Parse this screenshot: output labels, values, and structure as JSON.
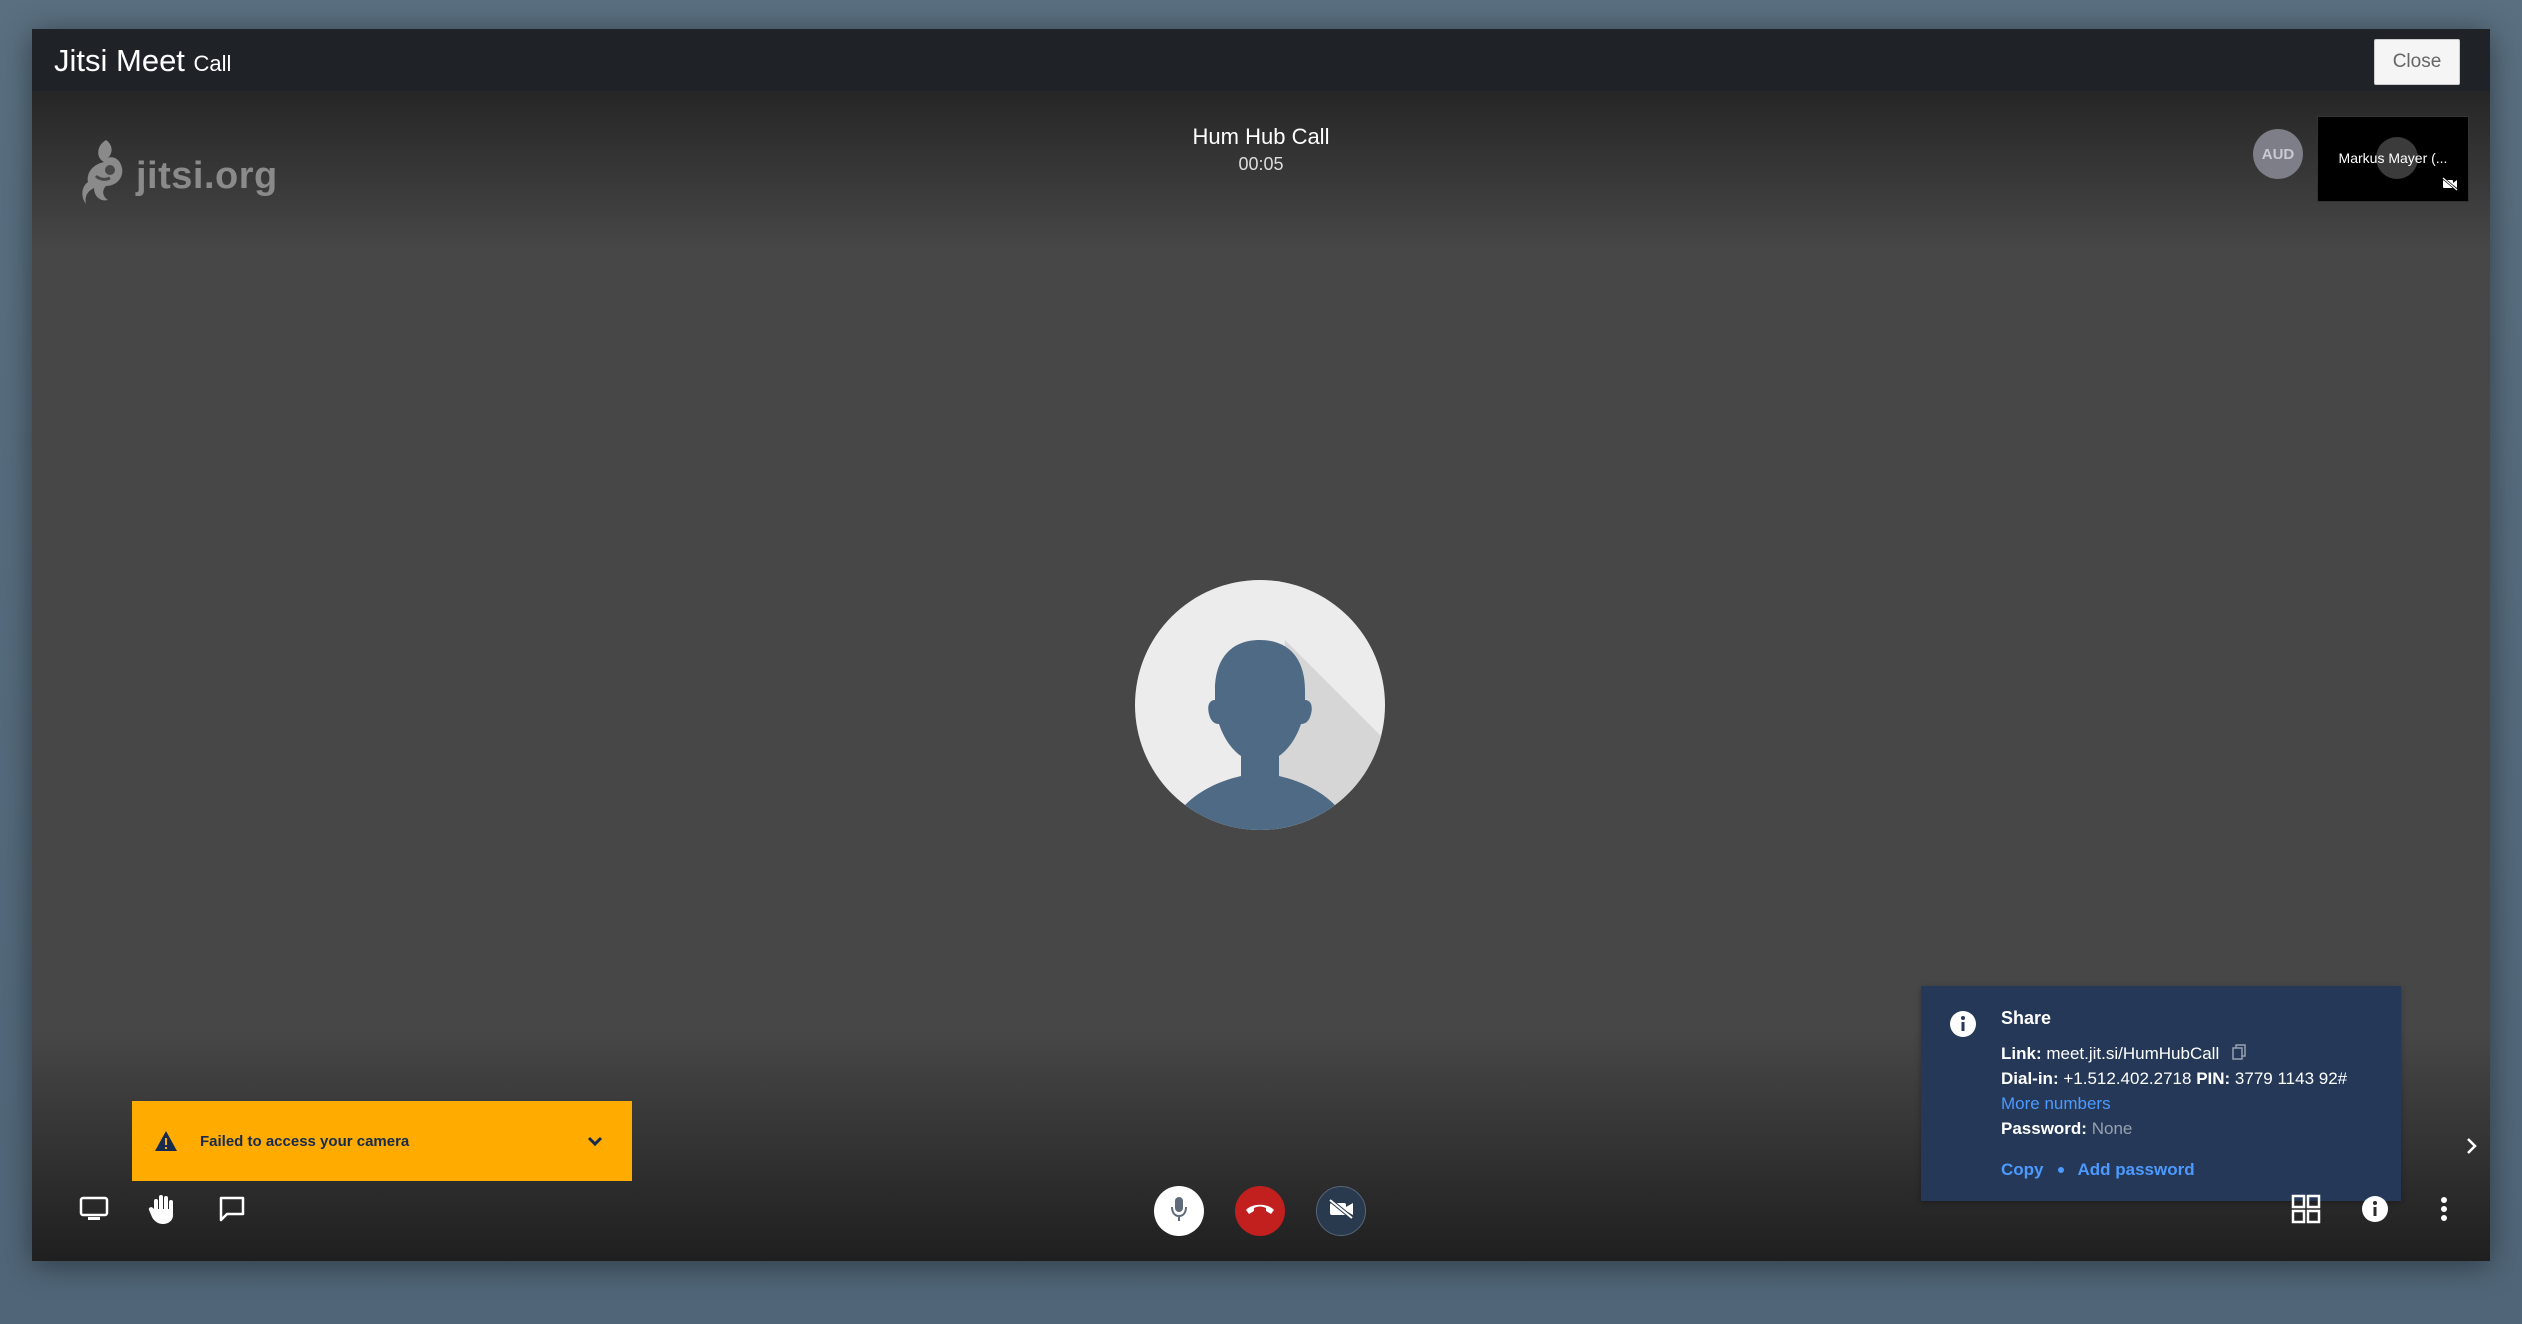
{
  "window": {
    "title": "Jitsi Meet",
    "subtitle": "Call",
    "close_label": "Close"
  },
  "logo": {
    "text": "jitsi.org",
    "icon": "jitsi-logo-icon"
  },
  "call": {
    "name": "Hum Hub Call",
    "timer": "00:05"
  },
  "filmstrip": {
    "audio_avatar_label": "AUD",
    "local_video_name": "Markus Mayer (...",
    "local_video_icon": "camera-off-icon"
  },
  "notification": {
    "message": "Failed to access your camera",
    "icon": "warning-icon",
    "expand_icon": "chevron-down-icon",
    "color": "#ffab00"
  },
  "share": {
    "title": "Share",
    "link_label": "Link:",
    "link_value": "meet.jit.si/HumHubCall",
    "dialin_label": "Dial-in:",
    "dialin_value": "+1.512.402.2718",
    "pin_label": "PIN:",
    "pin_value": "3779 1143 92#",
    "more_numbers": "More numbers",
    "password_label": "Password:",
    "password_value": "None",
    "copy_label": "Copy",
    "add_password_label": "Add password",
    "background": "#253858",
    "link_color": "#4c9aff"
  },
  "toolbar": {
    "left": [
      "screen-share-icon",
      "raise-hand-icon",
      "chat-icon"
    ],
    "center": [
      "microphone-icon",
      "hangup-icon",
      "camera-off-icon"
    ],
    "right": [
      "tile-view-icon",
      "info-icon",
      "more-options-icon"
    ],
    "hangup_color": "#c1201f"
  }
}
